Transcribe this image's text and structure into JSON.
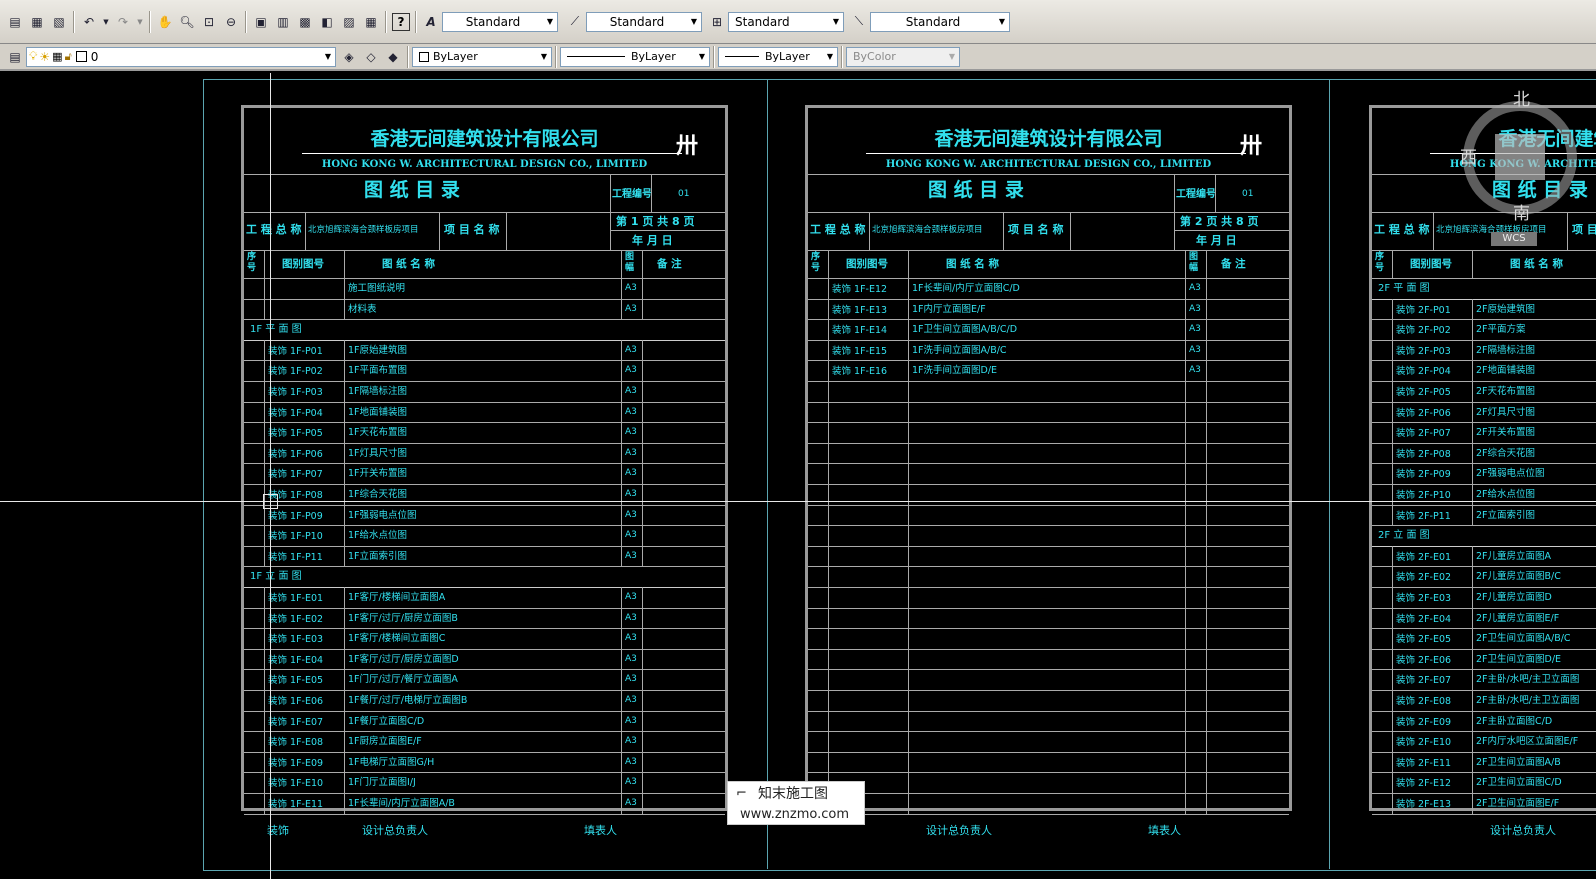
{
  "toolbar1": {
    "styles": [
      {
        "icon": "text-style-icon",
        "value": "Standard"
      },
      {
        "icon": "dim-style-icon",
        "value": "Standard"
      },
      {
        "icon": "table-style-icon",
        "value": "Standard"
      },
      {
        "icon": "multileader-style-icon",
        "value": "Standard"
      }
    ]
  },
  "toolbar2": {
    "layer_value": "0",
    "color_value": "ByLayer",
    "linetype_value": "ByLayer",
    "lineweight_value": "ByLayer",
    "plotstyle_value": "ByColor"
  },
  "sheet_common": {
    "company_cn": "香港无间建筑设计有限公司",
    "company_en": "HONG KONG W. ARCHITECTURAL DESIGN CO., LIMITED",
    "title": "图 纸 目 录",
    "project_no_label": "工程编号",
    "project_no_value": "01",
    "project_name_label": "工 程 总 称",
    "project_name_value": "北京旭辉滨海合颈样板房项目",
    "item_name_label": "项 目 名 称",
    "date_label": "年    月    日",
    "col_seq": "序号",
    "col_code": "图别图号",
    "col_name": "图  纸  名  称",
    "col_size": "图幅",
    "col_note": "备    注",
    "footer_a": "装饰",
    "footer_b": "设计总负责人",
    "footer_c": "填表人"
  },
  "sheets": [
    {
      "page": "第 1 页  共 8 页",
      "rows": [
        {
          "code": "",
          "name": "施工图纸说明",
          "size": "A3"
        },
        {
          "code": "",
          "name": "材料表",
          "size": "A3"
        },
        {
          "section": "1F  平  面  图"
        },
        {
          "code": "装饰  1F-P01",
          "name": "1F原始建筑图",
          "size": "A3"
        },
        {
          "code": "装饰  1F-P02",
          "name": "1F平面布置图",
          "size": "A3"
        },
        {
          "code": "装饰  1F-P03",
          "name": "1F隔墙标注图",
          "size": "A3"
        },
        {
          "code": "装饰  1F-P04",
          "name": "1F地面铺装图",
          "size": "A3"
        },
        {
          "code": "装饰  1F-P05",
          "name": "1F天花布置图",
          "size": "A3"
        },
        {
          "code": "装饰  1F-P06",
          "name": "1F灯具尺寸图",
          "size": "A3"
        },
        {
          "code": "装饰  1F-P07",
          "name": "1F开关布置图",
          "size": "A3"
        },
        {
          "code": "装饰  1F-P08",
          "name": "1F综合天花图",
          "size": "A3"
        },
        {
          "code": "装饰  1F-P09",
          "name": "1F强弱电点位图",
          "size": "A3"
        },
        {
          "code": "装饰  1F-P10",
          "name": "1F给水点位图",
          "size": "A3"
        },
        {
          "code": "装饰  1F-P11",
          "name": "1F立面索引图",
          "size": "A3"
        },
        {
          "section": "1F  立  面  图"
        },
        {
          "code": "装饰  1F-E01",
          "name": "1F客厅/楼梯间立面图A",
          "size": "A3"
        },
        {
          "code": "装饰  1F-E02",
          "name": "1F客厅/过厅/厨房立面图B",
          "size": "A3"
        },
        {
          "code": "装饰  1F-E03",
          "name": "1F客厅/楼梯间立面图C",
          "size": "A3"
        },
        {
          "code": "装饰  1F-E04",
          "name": "1F客厅/过厅/厨房立面图D",
          "size": "A3"
        },
        {
          "code": "装饰  1F-E05",
          "name": "1F门厅/过厅/餐厅立面图A",
          "size": "A3"
        },
        {
          "code": "装饰  1F-E06",
          "name": "1F餐厅/过厅/电梯厅立面图B",
          "size": "A3"
        },
        {
          "code": "装饰  1F-E07",
          "name": "1F餐厅立面图C/D",
          "size": "A3"
        },
        {
          "code": "装饰  1F-E08",
          "name": "1F厨房立面图E/F",
          "size": "A3"
        },
        {
          "code": "装饰  1F-E09",
          "name": "1F电梯厅立面图G/H",
          "size": "A3"
        },
        {
          "code": "装饰  1F-E10",
          "name": "1F门厅立面图I/J",
          "size": "A3"
        },
        {
          "code": "装饰  1F-E11",
          "name": "1F长辈间/内厅立面图A/B",
          "size": "A3"
        }
      ]
    },
    {
      "page": "第 2 页  共 8 页",
      "rows": [
        {
          "code": "装饰  1F-E12",
          "name": "1F长辈间/内厅立面图C/D",
          "size": "A3"
        },
        {
          "code": "装饰  1F-E13",
          "name": "1F内厅立面图E/F",
          "size": "A3"
        },
        {
          "code": "装饰  1F-E14",
          "name": "1F卫生间立面图A/B/C/D",
          "size": "A3"
        },
        {
          "code": "装饰  1F-E15",
          "name": "1F洗手间立面图A/B/C",
          "size": "A3"
        },
        {
          "code": "装饰  1F-E16",
          "name": "1F洗手间立面图D/E",
          "size": "A3"
        }
      ]
    },
    {
      "page": "",
      "rows": [
        {
          "section": "2F  平  面  图"
        },
        {
          "code": "装饰  2F-P01",
          "name": "2F原始建筑图",
          "size": ""
        },
        {
          "code": "装饰  2F-P02",
          "name": "2F平面方案",
          "size": ""
        },
        {
          "code": "装饰  2F-P03",
          "name": "2F隔墙标注图",
          "size": ""
        },
        {
          "code": "装饰  2F-P04",
          "name": "2F地面铺装图",
          "size": ""
        },
        {
          "code": "装饰  2F-P05",
          "name": "2F天花布置图",
          "size": ""
        },
        {
          "code": "装饰  2F-P06",
          "name": "2F灯具尺寸图",
          "size": ""
        },
        {
          "code": "装饰  2F-P07",
          "name": "2F开关布置图",
          "size": ""
        },
        {
          "code": "装饰  2F-P08",
          "name": "2F综合天花图",
          "size": ""
        },
        {
          "code": "装饰  2F-P09",
          "name": "2F强弱电点位图",
          "size": ""
        },
        {
          "code": "装饰  2F-P10",
          "name": "2F给水点位图",
          "size": ""
        },
        {
          "code": "装饰  2F-P11",
          "name": "2F立面索引图",
          "size": ""
        },
        {
          "section": "2F  立  面  图"
        },
        {
          "code": "装饰  2F-E01",
          "name": "2F儿童房立面图A",
          "size": ""
        },
        {
          "code": "装饰  2F-E02",
          "name": "2F儿童房立面图B/C",
          "size": ""
        },
        {
          "code": "装饰  2F-E03",
          "name": "2F儿童房立面图D",
          "size": ""
        },
        {
          "code": "装饰  2F-E04",
          "name": "2F儿童房立面图E/F",
          "size": ""
        },
        {
          "code": "装饰  2F-E05",
          "name": "2F卫生间立面图A/B/C",
          "size": ""
        },
        {
          "code": "装饰  2F-E06",
          "name": "2F卫生间立面图D/E",
          "size": ""
        },
        {
          "code": "装饰  2F-E07",
          "name": "2F主卧/水吧/主卫立面图",
          "size": ""
        },
        {
          "code": "装饰  2F-E08",
          "name": "2F主卧/水吧/主卫立面图",
          "size": ""
        },
        {
          "code": "装饰  2F-E09",
          "name": "2F主卧立面图C/D",
          "size": ""
        },
        {
          "code": "装饰  2F-E10",
          "name": "2F内厅水吧区立面图E/F",
          "size": ""
        },
        {
          "code": "装饰  2F-E11",
          "name": "2F卫生间立面图A/B",
          "size": ""
        },
        {
          "code": "装饰  2F-E12",
          "name": "2F卫生间立面图C/D",
          "size": ""
        },
        {
          "code": "装饰  2F-E13",
          "name": "2F卫生间立面图E/F",
          "size": ""
        }
      ]
    }
  ],
  "compass": {
    "north": "北",
    "west": "西",
    "south": "南",
    "wcs": "WCS"
  },
  "watermark": {
    "line1": "知末施工图",
    "line2": "www.znzmo.com"
  },
  "colors": {
    "cyan_text": "#32e0ee",
    "grid": "#aaaaaa",
    "frame": "#5ba5b0",
    "toolbar": "#d4d0c8"
  }
}
